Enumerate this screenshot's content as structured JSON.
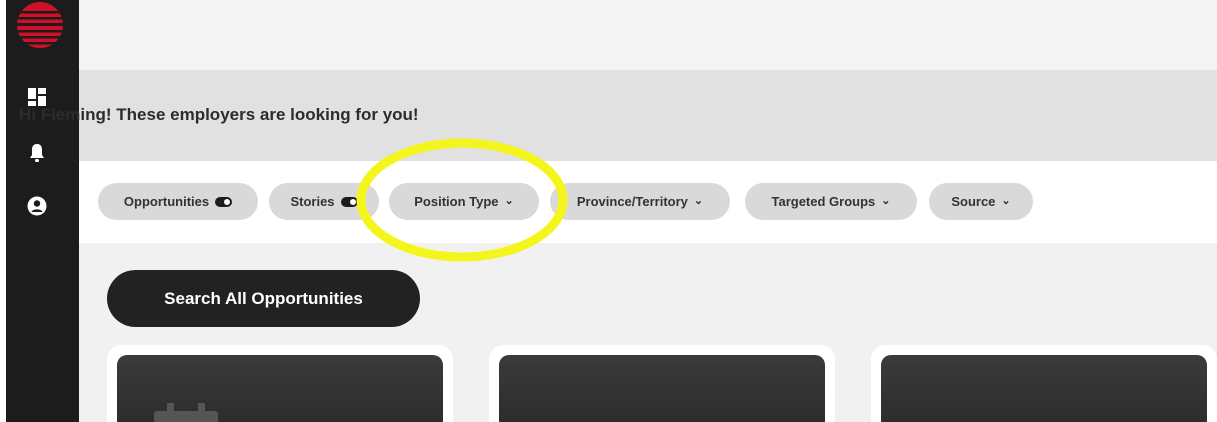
{
  "sidebar": {
    "logo": "brand-logo",
    "items": [
      {
        "icon": "dashboard-icon"
      },
      {
        "icon": "bell-icon"
      },
      {
        "icon": "user-circle-icon"
      }
    ]
  },
  "greeting": "Hi Fleming! These employers are looking for you!",
  "filters": [
    {
      "label": "Opportunities",
      "control": "toggle"
    },
    {
      "label": "Stories",
      "control": "toggle"
    },
    {
      "label": "Position Type",
      "control": "dropdown"
    },
    {
      "label": "Province/Territory",
      "control": "dropdown"
    },
    {
      "label": "Targeted Groups",
      "control": "dropdown"
    },
    {
      "label": "Source",
      "control": "dropdown"
    }
  ],
  "search_button": "Search All Opportunities",
  "colors": {
    "sidebar": "#1c1c1c",
    "brand_red": "#d0102a",
    "chip_bg": "#d9d9d9",
    "button_bg": "#222222",
    "annotation_yellow": "#f5f51e"
  }
}
